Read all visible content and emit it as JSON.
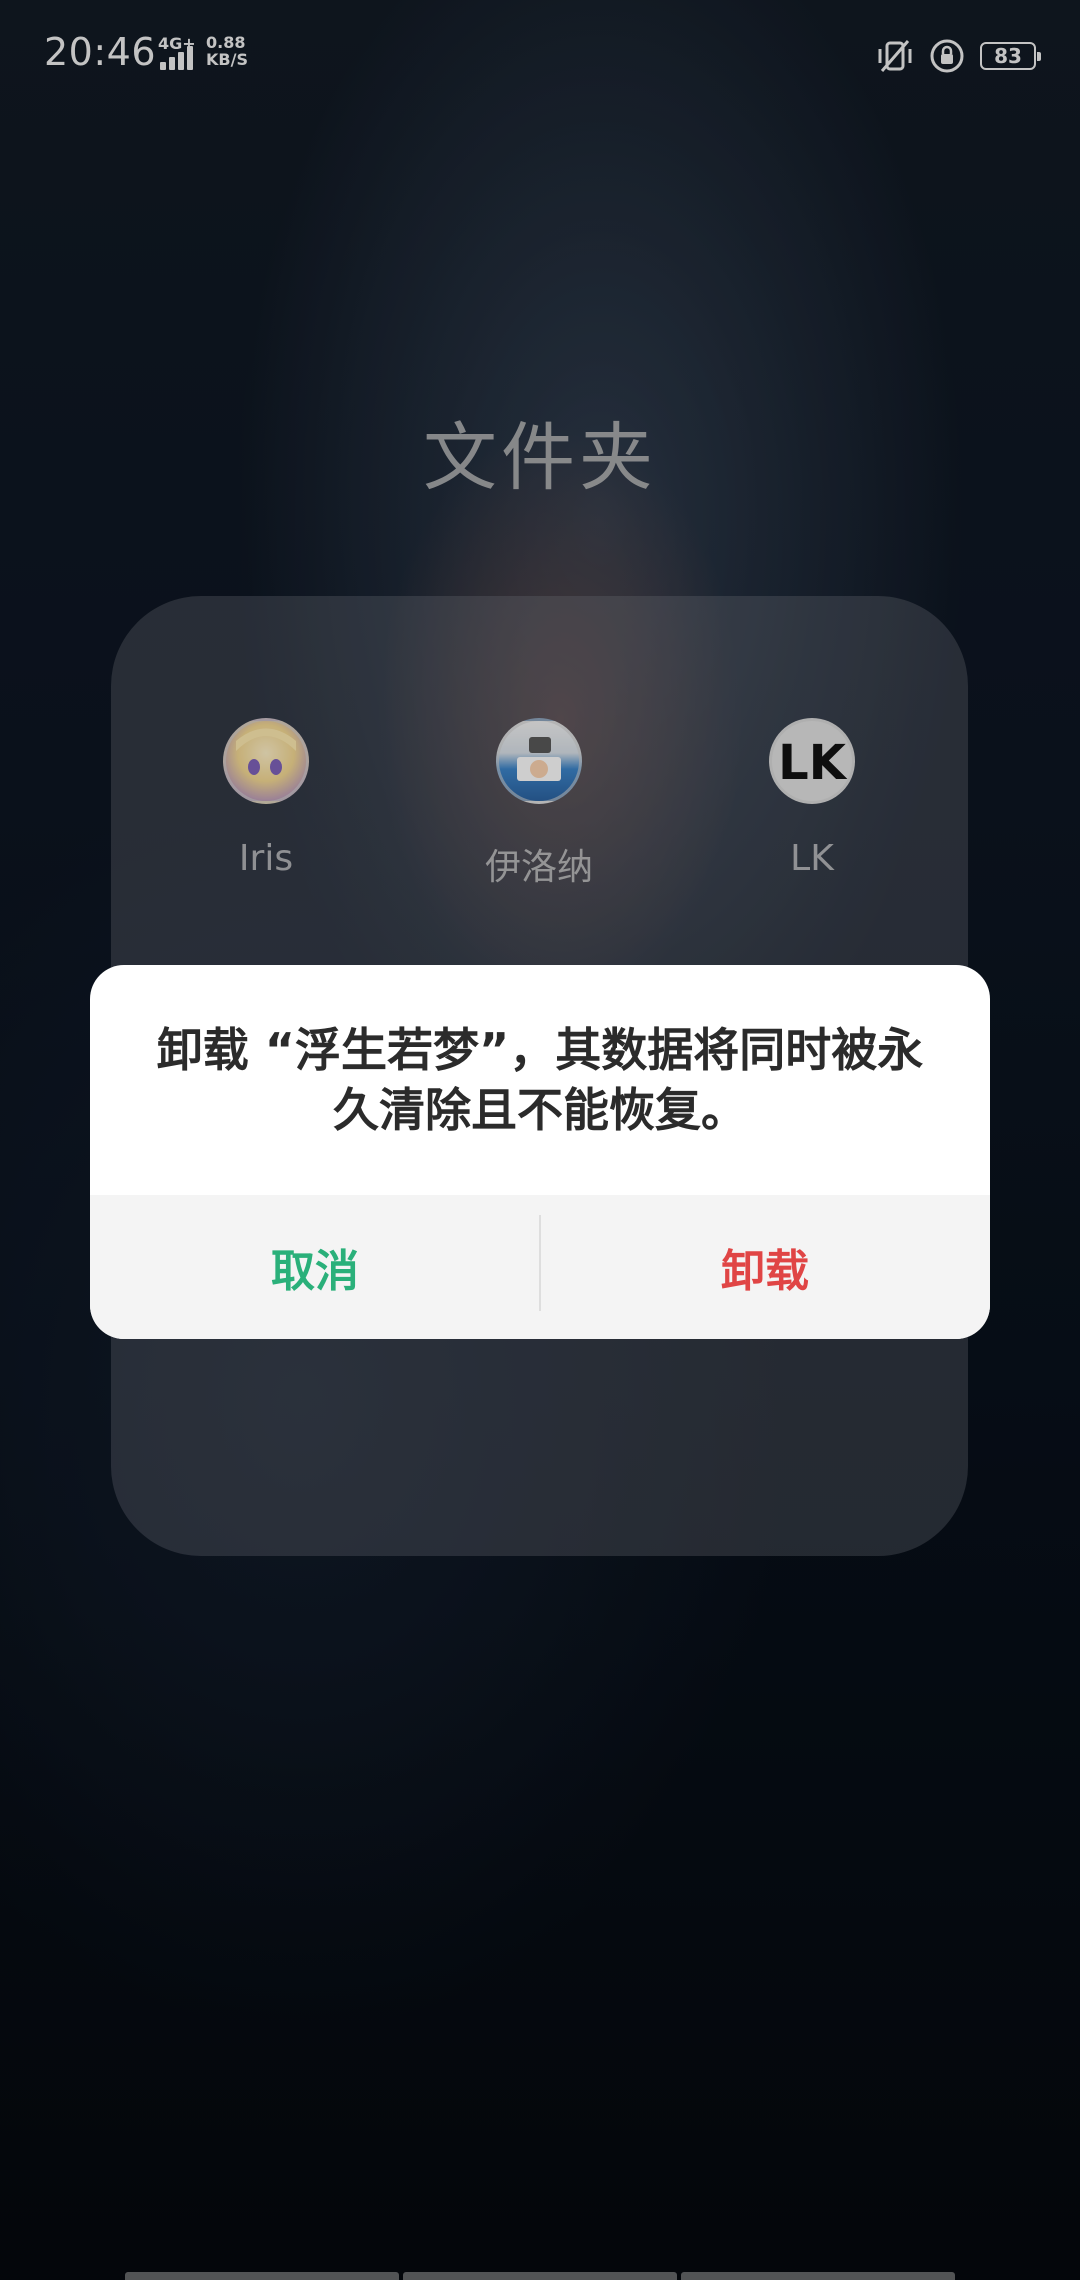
{
  "status_bar": {
    "time": "20:46",
    "network_type": "4G+",
    "net_speed_value": "0.88",
    "net_speed_unit": "KB/S",
    "battery_level": "83"
  },
  "folder": {
    "title": "文件夹",
    "apps": [
      {
        "label": "Iris",
        "icon": "anime-avatar-icon"
      },
      {
        "label": "伊洛纳",
        "icon": "anime-avatar-icon"
      },
      {
        "label": "LK",
        "icon": "lk-logo-icon"
      }
    ]
  },
  "dialog": {
    "message": "卸载 “浮生若梦”，其数据将同时被永久清除且不能恢复。",
    "cancel_label": "取消",
    "confirm_label": "卸载",
    "colors": {
      "cancel": "#2ab07a",
      "confirm": "#e04545"
    }
  }
}
